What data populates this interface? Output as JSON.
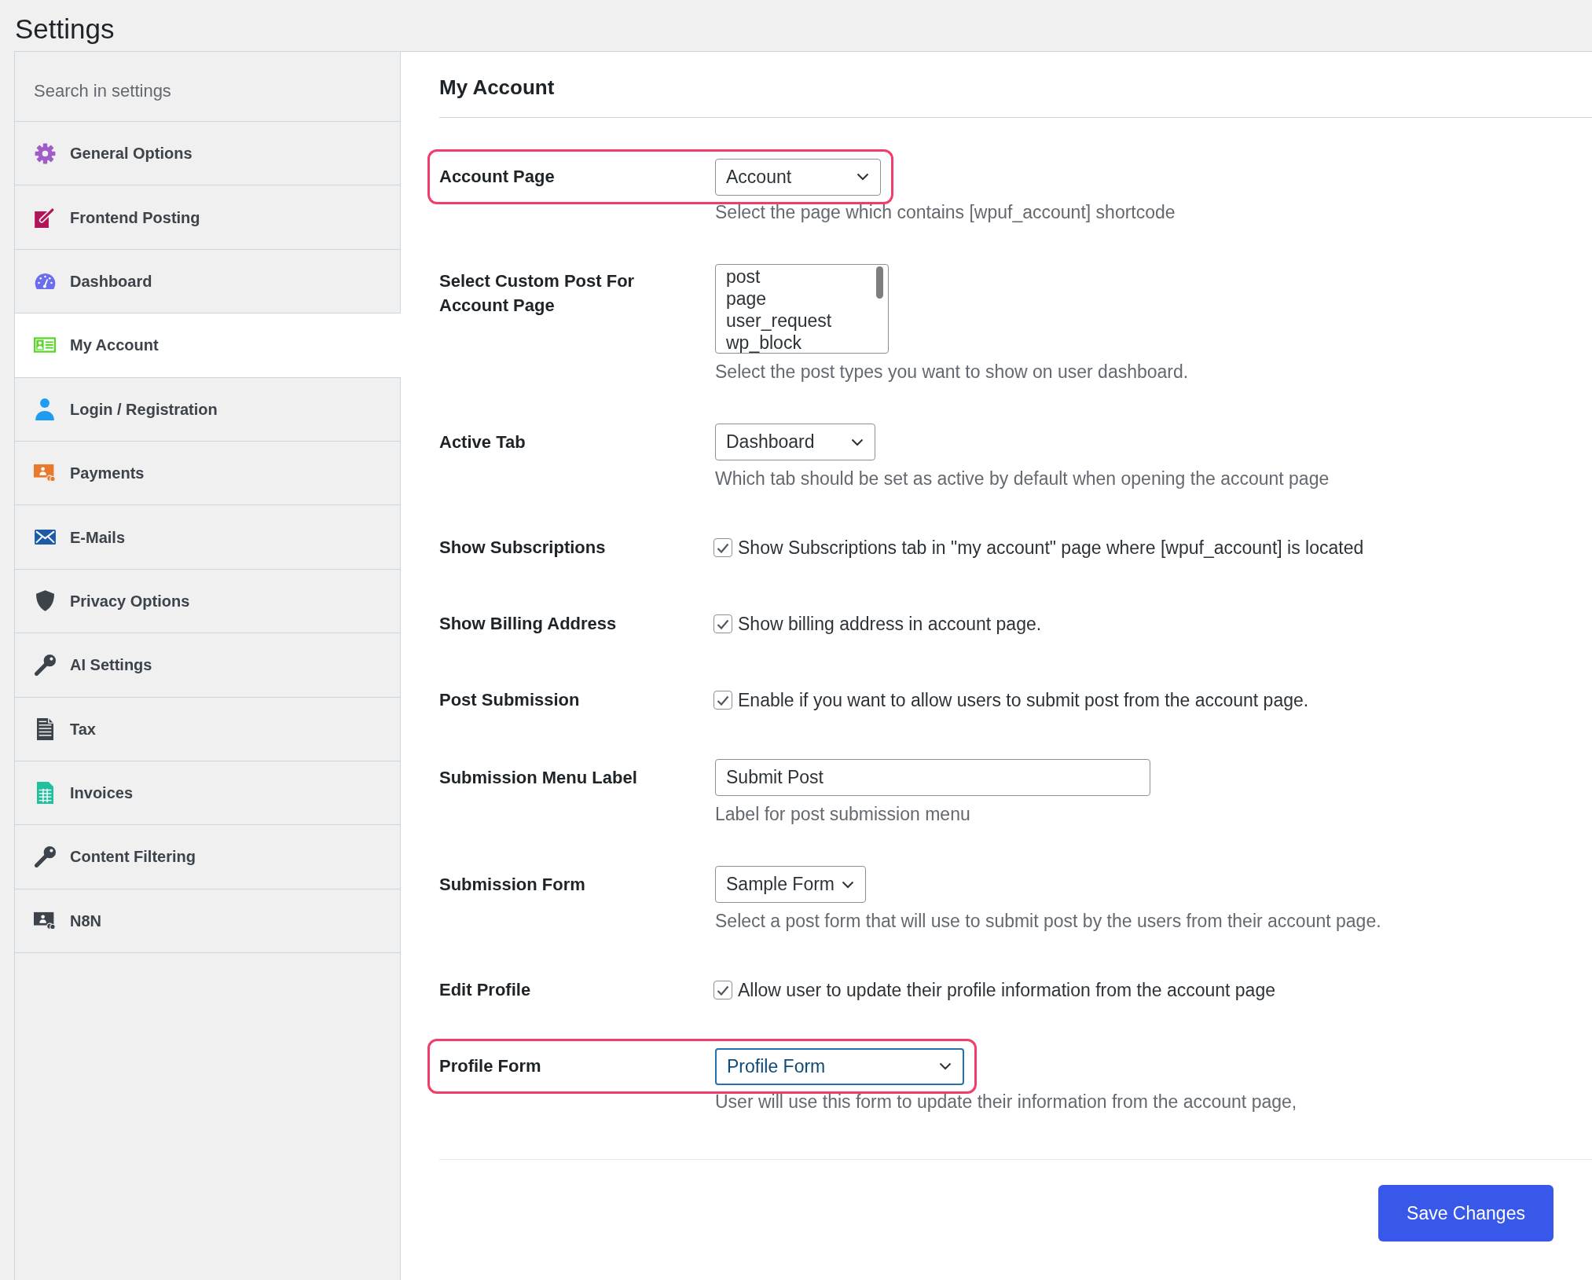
{
  "page_title": "Settings",
  "sidebar": {
    "search": {
      "placeholder": "Search in settings"
    },
    "items": [
      {
        "label": "General Options",
        "selected": false
      },
      {
        "label": "Frontend Posting",
        "selected": false
      },
      {
        "label": "Dashboard",
        "selected": false
      },
      {
        "label": "My Account",
        "selected": true
      },
      {
        "label": "Login / Registration",
        "selected": false
      },
      {
        "label": "Payments",
        "selected": false
      },
      {
        "label": "E-Mails",
        "selected": false
      },
      {
        "label": "Privacy Options",
        "selected": false
      },
      {
        "label": "AI Settings",
        "selected": false
      },
      {
        "label": "Tax",
        "selected": false
      },
      {
        "label": "Invoices",
        "selected": false
      },
      {
        "label": "Content Filtering",
        "selected": false
      },
      {
        "label": "N8N",
        "selected": false
      }
    ]
  },
  "panel": {
    "title": "My Account",
    "settings": [
      {
        "kind": "select",
        "label": "Account Page",
        "value": "Account",
        "focused": false,
        "highlighted": true,
        "description": "Select the page which contains [wpuf_account] shortcode"
      },
      {
        "kind": "listbox",
        "label": "Select Custom Post For Account Page",
        "highlighted": false,
        "options": [
          {
            "label": "post",
            "selected": false
          },
          {
            "label": "page",
            "selected": false
          },
          {
            "label": "user_request",
            "selected": false
          },
          {
            "label": "wp_block",
            "selected": false
          }
        ],
        "description": "Select the post types you want to show on user dashboard."
      },
      {
        "kind": "select",
        "label": "Active Tab",
        "value": "Dashboard",
        "focused": false,
        "highlighted": false,
        "description": "Which tab should be set as active by default when opening the account page"
      },
      {
        "kind": "checkbox",
        "label": "Show Subscriptions",
        "checked": true,
        "highlighted": false,
        "text": "Show Subscriptions tab in \"my account\" page where [wpuf_account] is located"
      },
      {
        "kind": "checkbox",
        "label": "Show Billing Address",
        "checked": true,
        "highlighted": false,
        "text": "Show billing address in account page."
      },
      {
        "kind": "checkbox",
        "label": "Post Submission",
        "checked": true,
        "highlighted": false,
        "text": "Enable if you want to allow users to submit post from the account page."
      },
      {
        "kind": "text",
        "label": "Submission Menu Label",
        "value": "Submit Post",
        "focused": false,
        "highlighted": false,
        "description": "Label for post submission menu"
      },
      {
        "kind": "select",
        "label": "Submission Form",
        "value": "Sample Form",
        "focused": false,
        "highlighted": false,
        "description": "Select a post form that will use to submit post by the users from their account page."
      },
      {
        "kind": "checkbox",
        "label": "Edit Profile",
        "checked": true,
        "highlighted": false,
        "text": "Allow user to update their profile information from the account page"
      },
      {
        "kind": "select",
        "label": "Profile Form",
        "value": "Profile Form",
        "focused": true,
        "highlighted": true,
        "description": "User will use this form to update their information from the account page,"
      }
    ]
  },
  "save_button": {
    "label": "Save Changes"
  }
}
